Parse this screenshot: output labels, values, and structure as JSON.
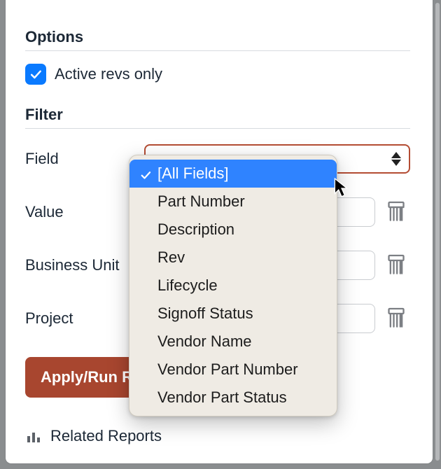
{
  "sections": {
    "options_title": "Options",
    "filter_title": "Filter"
  },
  "options": {
    "active_revs_label": "Active revs only",
    "active_revs_checked": true
  },
  "filter": {
    "rows": [
      {
        "label": "Field"
      },
      {
        "label": "Value"
      },
      {
        "label": "Business Unit"
      },
      {
        "label": "Project"
      }
    ],
    "apply_label": "Apply/Run Report"
  },
  "field_dropdown": {
    "selected_index": 0,
    "items": [
      "[All Fields]",
      "Part Number",
      "Description",
      "Rev",
      "Lifecycle",
      "Signoff Status",
      "Vendor Name",
      "Vendor Part Number",
      "Vendor Part Status"
    ]
  },
  "footer": {
    "related_label": "Related Reports"
  },
  "colors": {
    "accent_blue": "#0a7aff",
    "select_border": "#b44c33",
    "primary_button": "#a8462f",
    "highlight": "#2f83ff"
  }
}
